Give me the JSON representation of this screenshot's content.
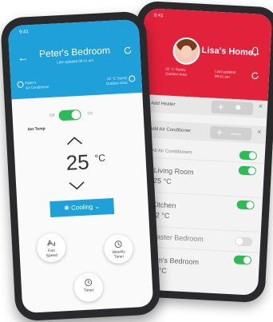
{
  "home_screen": {
    "status_time": "9:41",
    "home_title": "Lisa's Home",
    "weather_line1": "22 °C Sunny",
    "weather_line2": "Outdoor Area",
    "update_line1": "Last updated",
    "update_line2": "09:41 am",
    "add_bars": [
      {
        "label": "Add Heater"
      },
      {
        "label": "Add Air Conditioner"
      }
    ],
    "list_header": "All Air Conditioners",
    "rooms": [
      {
        "name": "Living Room",
        "temp": "25 °C",
        "on": true
      },
      {
        "name": "Kitchen",
        "temp": "22 °C",
        "on": true
      },
      {
        "name": "Master Bedroom",
        "temp": "",
        "on": false
      },
      {
        "name": "Tom's Bedroom",
        "temp": "24 °C",
        "on": true
      }
    ],
    "accent_color": "#e2223b",
    "on_color": "#2dbb57"
  },
  "room_screen": {
    "status_time": "9:41",
    "title": "Peter's Bedroom",
    "subtitle": "Last updated 09:41 am",
    "meta_left1": "Peter's",
    "meta_left2": "Air Conditioner",
    "meta_right1": "22 °C Sunny",
    "meta_right2": "Outdoor Area",
    "power_off": "Off",
    "power_on": "On",
    "set_temp_label": "Set Temp",
    "temperature": "25",
    "unit": "°C",
    "mode": "Cooling",
    "fan_label1": "Fan",
    "fan_label2": "Speed",
    "weekly_label1": "Weekly",
    "weekly_label2": "Timer",
    "timer_label": "Timer",
    "accent_color": "#1fa0d8"
  }
}
